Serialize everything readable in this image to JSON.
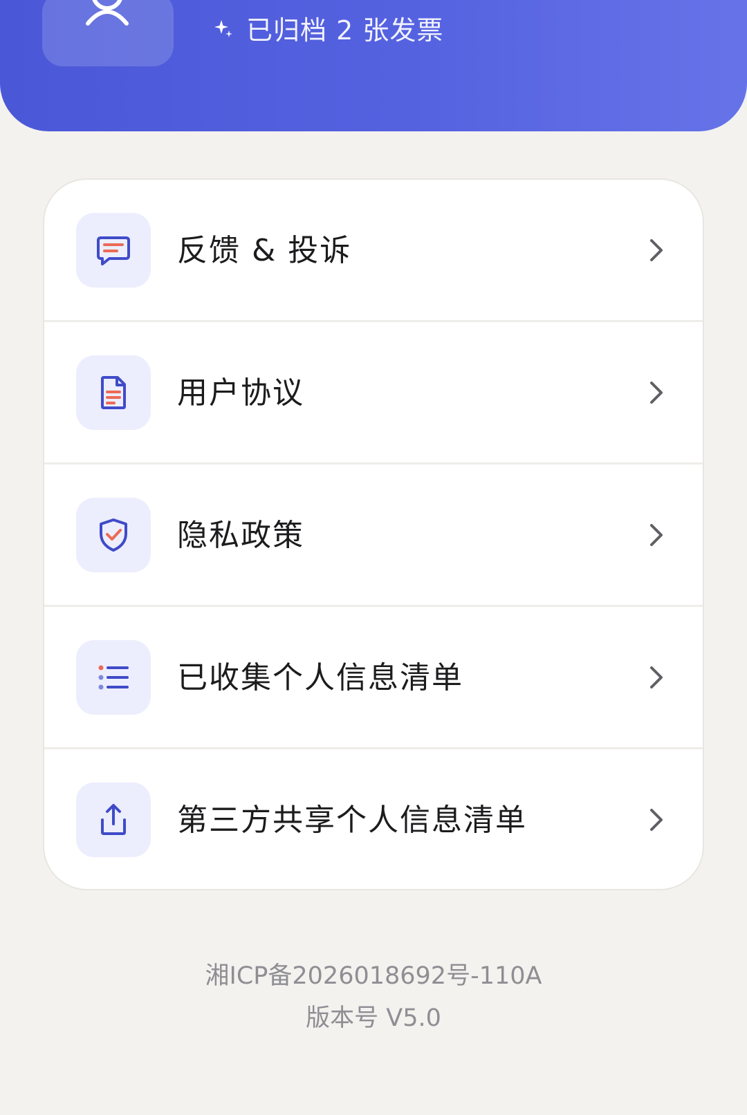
{
  "header": {
    "archived_text": "已归档 2 张发票",
    "sparkle_icon": "sparkle-icon",
    "avatar_icon": "user-avatar-icon",
    "gradient_colors": [
      "#4a58d8",
      "#6673e8"
    ]
  },
  "menu": {
    "items": [
      {
        "label": "反馈 & 投诉",
        "icon": "feedback-message-icon"
      },
      {
        "label": "用户协议",
        "icon": "document-icon"
      },
      {
        "label": "隐私政策",
        "icon": "shield-check-icon"
      },
      {
        "label": "已收集个人信息清单",
        "icon": "list-icon"
      },
      {
        "label": "第三方共享个人信息清单",
        "icon": "share-upload-icon"
      }
    ],
    "chevron_icon": "chevron-right-icon"
  },
  "footer": {
    "icp": "湘ICP备2026018692号-110A",
    "version": "版本号 V5.0"
  },
  "colors": {
    "accent": "#3f4bc8",
    "accent_red": "#ec6a55",
    "icon_bg": "#eceefd",
    "page_bg": "#f3f2ef",
    "card_bg": "#ffffff"
  }
}
